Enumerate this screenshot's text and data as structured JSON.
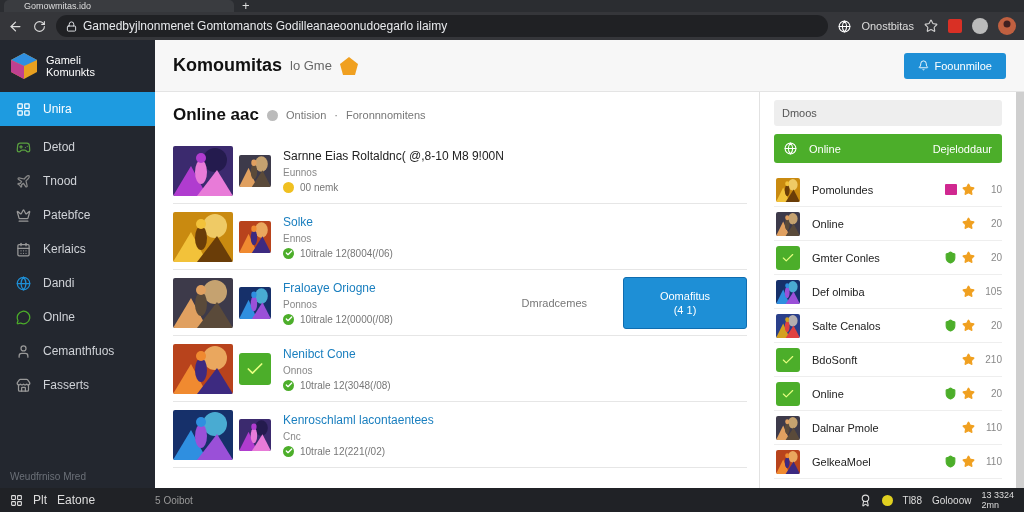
{
  "browser": {
    "tab_title": "Gomowmitas.ido",
    "new_tab": "+",
    "address": "Gamedbyjlnonmenet Gomtomanots Godilleanaeoonudoegarlo ilaimy",
    "profile_label": "Onostbitas"
  },
  "app": {
    "logo_line1": "Gameli",
    "logo_line2": "Komunkts",
    "title": "Komoumitas",
    "subtitle": "lo Gme",
    "header_button": "Foounmiloe"
  },
  "sidebar": {
    "items": [
      {
        "label": "Unira",
        "selected": true
      },
      {
        "label": "Detod",
        "selected": false
      },
      {
        "label": "Tnood",
        "selected": false
      },
      {
        "label": "Patebfce",
        "selected": false
      },
      {
        "label": "Kerlaics",
        "selected": false
      },
      {
        "label": "Dandi",
        "selected": false
      },
      {
        "label": "Onlne",
        "selected": false
      },
      {
        "label": "Cemanthfuos",
        "selected": false
      },
      {
        "label": "Fasserts",
        "selected": false
      }
    ],
    "footer": "Weudfrniso Mred"
  },
  "feed": {
    "title": "Online aac",
    "meta_1": "Ontision",
    "separator": "·",
    "meta_2": "Foronnnomitens",
    "items": [
      {
        "title": {
          "kind": "plain",
          "text": "Sarnne Eias Roltaldnc( @,8-10 M8 9!00N"
        },
        "subtitle": "Eunnos",
        "status": {
          "kind": "coin",
          "text": "00 nemk"
        },
        "avatar": {
          "kind": "picture"
        }
      },
      {
        "title": {
          "kind": "link",
          "text": "Solke"
        },
        "subtitle": "Ennos",
        "status": {
          "kind": "check",
          "text": "10itrale 12(8004(/06)"
        },
        "avatar": {
          "kind": "picture"
        }
      },
      {
        "title": {
          "kind": "link",
          "text": "Fraloaye Oriogne"
        },
        "subtitle": "Ponnos",
        "status": {
          "kind": "check",
          "text": "10itrale 12(0000(/08)"
        },
        "avatar": {
          "kind": "picture"
        },
        "note": "Dmradcemes",
        "action": "Oomafitus",
        "action_count": "(4 1)"
      },
      {
        "title": {
          "kind": "link",
          "text": "Nenibct Cone"
        },
        "subtitle": "Onnos",
        "status": {
          "kind": "check",
          "text": "10trale 12(3048(/08)"
        },
        "avatar": {
          "kind": "app"
        }
      },
      {
        "title": {
          "kind": "link",
          "text": "Kenroschlaml lacontaentees"
        },
        "subtitle": "Cnc",
        "status": {
          "kind": "check",
          "text": "10trale 12(221(/02)"
        },
        "avatar": {
          "kind": "picture"
        }
      }
    ]
  },
  "panel": {
    "search": {
      "placeholder": "Dmoos"
    },
    "online_label": "Online",
    "online_action": "Dejeloddaur",
    "entries": [
      {
        "name": "Pomolundes",
        "count": "10",
        "avatar": {
          "kind": "picture"
        },
        "badges": [
          {
            "kind": "tag"
          },
          {
            "kind": "star"
          }
        ]
      },
      {
        "name": "Online",
        "count": "20",
        "avatar": {
          "kind": "picture"
        },
        "badges": [
          {
            "kind": "star"
          }
        ]
      },
      {
        "name": "Gmter Conles",
        "count": "20",
        "avatar": {
          "kind": "app"
        },
        "badges": [
          {
            "kind": "shield"
          },
          {
            "kind": "star"
          }
        ]
      },
      {
        "name": "Def olmiba",
        "count": "105",
        "avatar": {
          "kind": "picture"
        },
        "badges": [
          {
            "kind": "star"
          }
        ]
      },
      {
        "name": "Salte Cenalos",
        "count": "20",
        "avatar": {
          "kind": "picture"
        },
        "badges": [
          {
            "kind": "shield"
          },
          {
            "kind": "star"
          }
        ]
      },
      {
        "name": "BdoSonft",
        "count": "210",
        "avatar": {
          "kind": "app"
        },
        "badges": [
          {
            "kind": "star"
          }
        ]
      },
      {
        "name": "Online",
        "count": "20",
        "avatar": {
          "kind": "app"
        },
        "badges": [
          {
            "kind": "shield"
          },
          {
            "kind": "star"
          }
        ]
      },
      {
        "name": "Dalnar Pmole",
        "count": "110",
        "avatar": {
          "kind": "picture"
        },
        "badges": [
          {
            "kind": "star"
          }
        ]
      },
      {
        "name": "GelkeaMoel",
        "count": "110",
        "avatar": {
          "kind": "picture"
        },
        "badges": [
          {
            "kind": "shield"
          },
          {
            "kind": "star"
          }
        ]
      }
    ]
  },
  "taskbar": {
    "start_label": "Plt",
    "app_label": "Eatone",
    "center_label": "5 Ooibot",
    "tray_label_1": "Tl88",
    "tray_label_2": "Golooow",
    "date": "13 3324",
    "time": "2mn"
  }
}
